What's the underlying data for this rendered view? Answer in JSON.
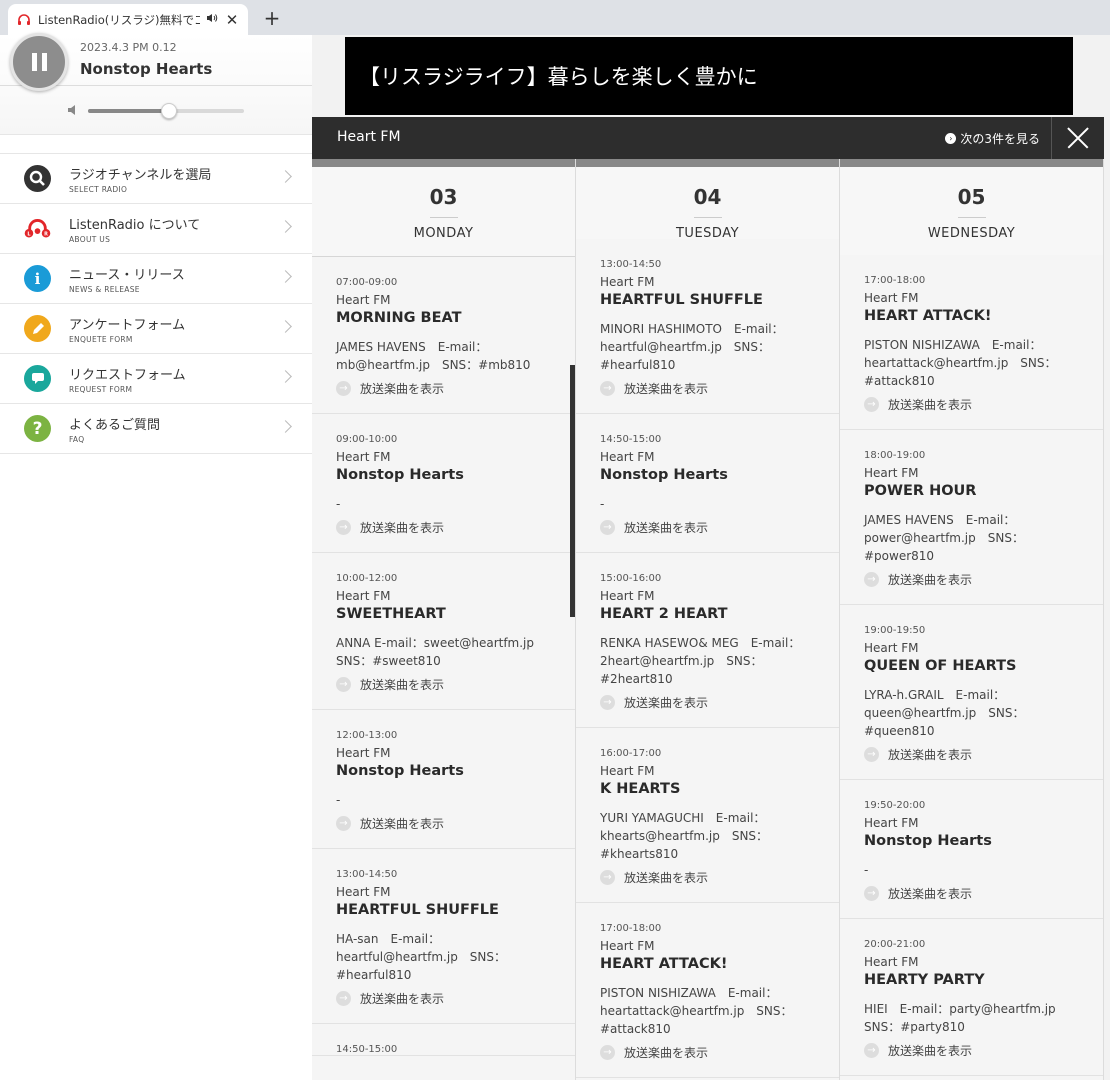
{
  "browser": {
    "tab_title": "ListenRadio(リスラジ)無料でコミ",
    "new_tab": "+",
    "close": "✕"
  },
  "player": {
    "date": "2023.4.3  PM 0.12",
    "title": "Nonstop Hearts",
    "volume_level": 0.52
  },
  "menu": [
    {
      "jp": "ラジオチャンネルを選局",
      "en": "SELECT RADIO",
      "icon": "search-icon",
      "color": "#333333"
    },
    {
      "jp": "ListenRadio について",
      "en": "ABOUT US",
      "icon": "listenradio-logo-icon",
      "color": "#e2262a"
    },
    {
      "jp": "ニュース・リリース",
      "en": "NEWS & RELEASE",
      "icon": "info-icon",
      "color": "#1a9bd7"
    },
    {
      "jp": "アンケートフォーム",
      "en": "ENQUETE FORM",
      "icon": "pencil-icon",
      "color": "#f0a81c"
    },
    {
      "jp": "リクエストフォーム",
      "en": "REQUEST FORM",
      "icon": "chat-bubble-icon",
      "color": "#1aa79c"
    },
    {
      "jp": "よくあるご質問",
      "en": "FAQ",
      "icon": "question-icon",
      "color": "#7cb342"
    }
  ],
  "banner": "【リスラジライフ】暮らしを楽しく豊かに",
  "schedule": {
    "station": "Heart FM",
    "next_label": "次の3件を見る",
    "song_link": "放送楽曲を表示",
    "days": [
      {
        "num": "03",
        "weekday": "MONDAY",
        "programs": [
          {
            "time": "07:00-09:00",
            "station": "Heart FM",
            "name": "MORNING BEAT",
            "desc": "JAMES HAVENS　E-mail：mb@heartfm.jp　SNS：#mb810"
          },
          {
            "time": "09:00-10:00",
            "station": "Heart FM",
            "name": "Nonstop Hearts",
            "desc": "-"
          },
          {
            "time": "10:00-12:00",
            "station": "Heart FM",
            "name": "SWEETHEART",
            "desc": "ANNA E-mail：sweet@heartfm.jp　SNS：#sweet810"
          },
          {
            "time": "12:00-13:00",
            "station": "Heart FM",
            "name": "Nonstop Hearts",
            "desc": "-"
          },
          {
            "time": "13:00-14:50",
            "station": "Heart FM",
            "name": "HEARTFUL SHUFFLE",
            "desc": "HA-san　E-mail：heartful@heartfm.jp　SNS：#hearful810"
          },
          {
            "time": "14:50-15:00",
            "station": "",
            "name": "",
            "desc": ""
          }
        ]
      },
      {
        "num": "04",
        "weekday": "TUESDAY",
        "programs": [
          {
            "time": "13:00-14:50",
            "station": "Heart FM",
            "name": "HEARTFUL SHUFFLE",
            "desc": "MINORI HASHIMOTO　E-mail：heartful@heartfm.jp　SNS：#hearful810"
          },
          {
            "time": "14:50-15:00",
            "station": "Heart FM",
            "name": "Nonstop Hearts",
            "desc": "-"
          },
          {
            "time": "15:00-16:00",
            "station": "Heart FM",
            "name": "HEART 2 HEART",
            "desc": "RENKA HASEWO& MEG　E-mail：2heart@heartfm.jp　SNS：#2heart810"
          },
          {
            "time": "16:00-17:00",
            "station": "Heart FM",
            "name": "K HEARTS",
            "desc": "YURI YAMAGUCHI　E-mail：khearts@heartfm.jp　SNS：#khearts810"
          },
          {
            "time": "17:00-18:00",
            "station": "Heart FM",
            "name": "HEART ATTACK!",
            "desc": "PISTON NISHIZAWA　E-mail：heartattack@heartfm.jp　SNS：#attack810"
          }
        ]
      },
      {
        "num": "05",
        "weekday": "WEDNESDAY",
        "programs": [
          {
            "time": "17:00-18:00",
            "station": "Heart FM",
            "name": "HEART ATTACK!",
            "desc": "PISTON NISHIZAWA　E-mail：heartattack@heartfm.jp　SNS：#attack810"
          },
          {
            "time": "18:00-19:00",
            "station": "Heart FM",
            "name": "POWER HOUR",
            "desc": "JAMES HAVENS　E-mail：power@heartfm.jp　SNS：#power810"
          },
          {
            "time": "19:00-19:50",
            "station": "Heart FM",
            "name": "QUEEN OF HEARTS",
            "desc": "LYRA-h.GRAIL　E-mail：queen@heartfm.jp　SNS：#queen810"
          },
          {
            "time": "19:50-20:00",
            "station": "Heart FM",
            "name": "Nonstop Hearts",
            "desc": "-"
          },
          {
            "time": "20:00-21:00",
            "station": "Heart FM",
            "name": "HEARTY PARTY",
            "desc": "HIEI　E-mail：party@heartfm.jp　SNS：#party810"
          }
        ]
      }
    ]
  }
}
